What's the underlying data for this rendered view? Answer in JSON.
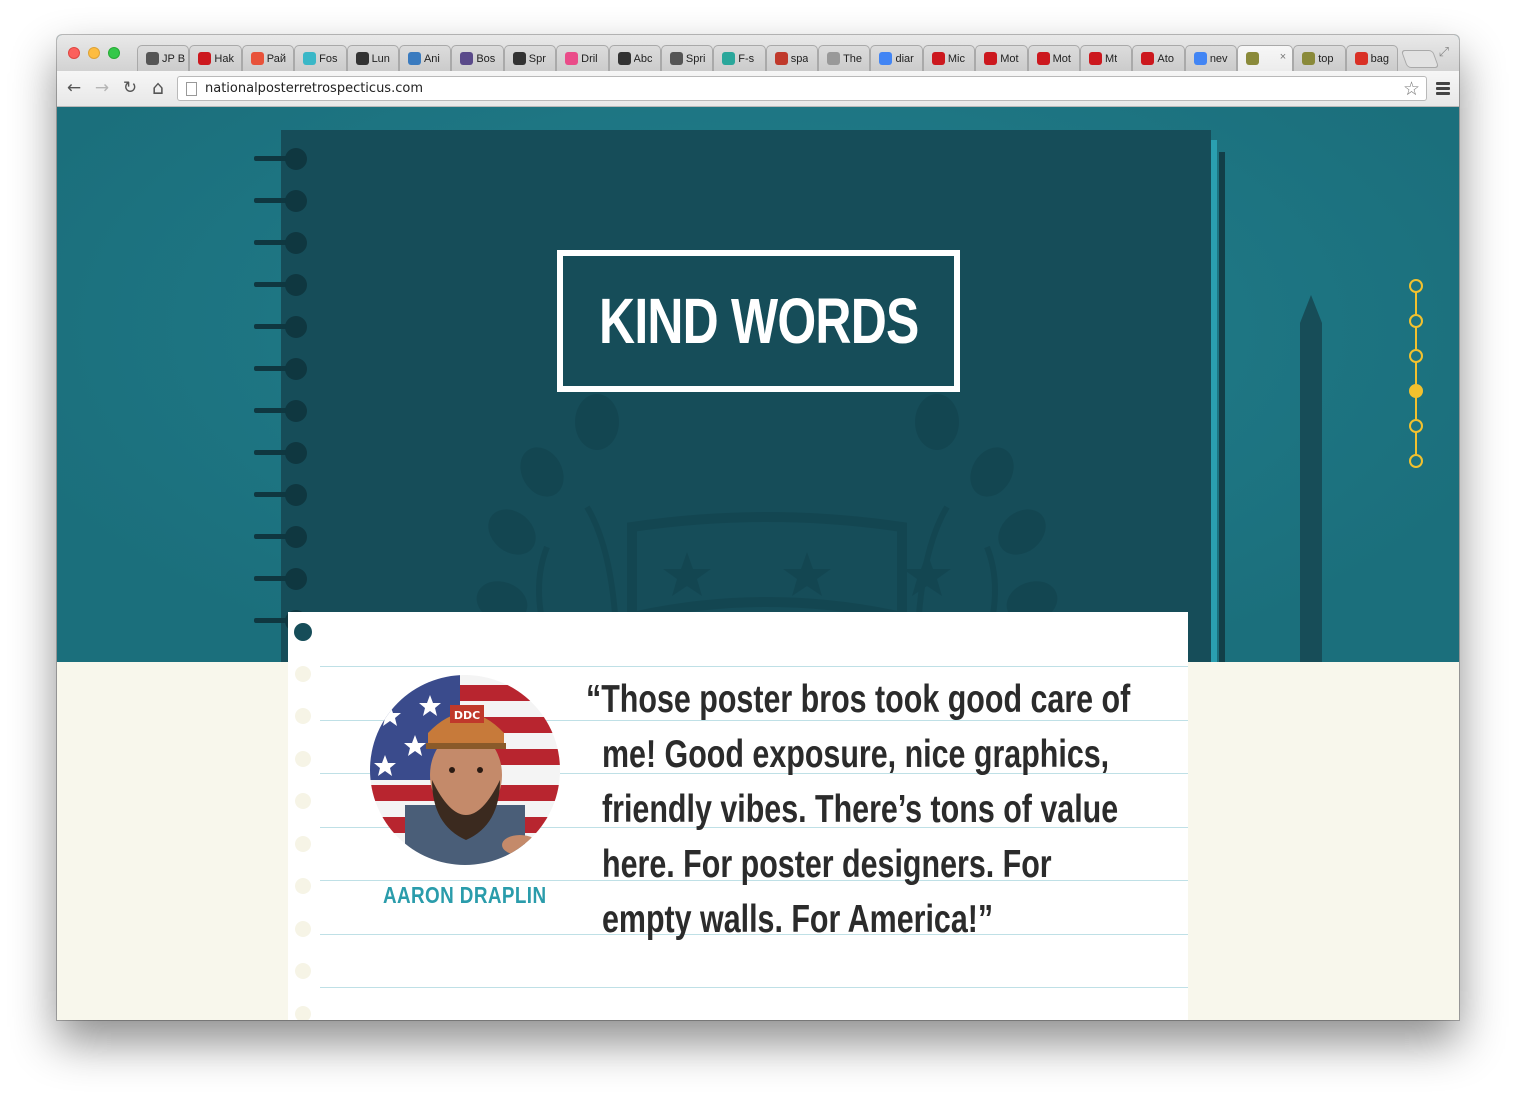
{
  "browser": {
    "tabs": [
      {
        "title": "JP B",
        "icon": "wordpress-icon",
        "color": "#555555"
      },
      {
        "title": "Hak",
        "icon": "youtube-icon",
        "color": "#cc181e"
      },
      {
        "title": "Рай",
        "icon": "pencil-icon",
        "color": "#e8523a"
      },
      {
        "title": "Fos",
        "icon": "heart-icon",
        "color": "#3ab7c7"
      },
      {
        "title": "Lun",
        "icon": "u-logo-icon",
        "color": "#333333"
      },
      {
        "title": "Ani",
        "icon": "drop-icon",
        "color": "#3a7bbf"
      },
      {
        "title": "Bos",
        "icon": "circle-logo-icon",
        "color": "#5a4a8a"
      },
      {
        "title": "Spr",
        "icon": "bolt-icon",
        "color": "#333333"
      },
      {
        "title": "Dril",
        "icon": "dribbble-icon",
        "color": "#ea4c89"
      },
      {
        "title": "Abc",
        "icon": "bolt-icon",
        "color": "#333333"
      },
      {
        "title": "Spri",
        "icon": "wikipedia-icon",
        "color": "#555555"
      },
      {
        "title": "F-s",
        "icon": "jpb-icon",
        "color": "#2aa79b"
      },
      {
        "title": "spa",
        "icon": "sp-logo-icon",
        "color": "#c0392b"
      },
      {
        "title": "The",
        "icon": "page-icon",
        "color": "#999999"
      },
      {
        "title": "diar",
        "icon": "google-icon",
        "color": "#4285f4"
      },
      {
        "title": "Mic",
        "icon": "youtube-icon",
        "color": "#cc181e"
      },
      {
        "title": "Mot",
        "icon": "youtube-icon",
        "color": "#cc181e"
      },
      {
        "title": "Mot",
        "icon": "youtube-icon",
        "color": "#cc181e"
      },
      {
        "title": "Mt",
        "icon": "youtube-icon",
        "color": "#cc181e"
      },
      {
        "title": "Ato",
        "icon": "youtube-icon",
        "color": "#cc181e"
      },
      {
        "title": "nev",
        "icon": "google-icon",
        "color": "#4285f4"
      },
      {
        "title": "",
        "icon": "seal-icon",
        "color": "#8a8a3a",
        "active": true
      },
      {
        "title": "top",
        "icon": "seal-icon",
        "color": "#8a8a3a"
      },
      {
        "title": "bag",
        "icon": "gmail-icon",
        "color": "#d93025"
      }
    ],
    "url": "nationalposterretrospecticus.com",
    "icons": {
      "back": "←",
      "forward": "→",
      "reload": "↻",
      "home": "⌂",
      "star": "☆",
      "fullscreen": "⤢",
      "close": "×"
    }
  },
  "page": {
    "section_title": "KIND WORDS",
    "testimonial": {
      "name": "AARON DRAPLIN",
      "quote_lines": [
        "“Those poster bros took good care of",
        "me! Good exposure, nice graphics,",
        "friendly vibes. There’s tons of value",
        "here. For poster designers. For",
        "empty walls. For America!”"
      ],
      "hat_text": "DDC"
    },
    "dot_nav": {
      "count": 6,
      "active_index": 3
    },
    "colors": {
      "teal": "#1d7482",
      "notebook": "#164d59",
      "accent": "#f2c12e",
      "name": "#2a9cab",
      "cream": "#f8f7ec"
    }
  }
}
